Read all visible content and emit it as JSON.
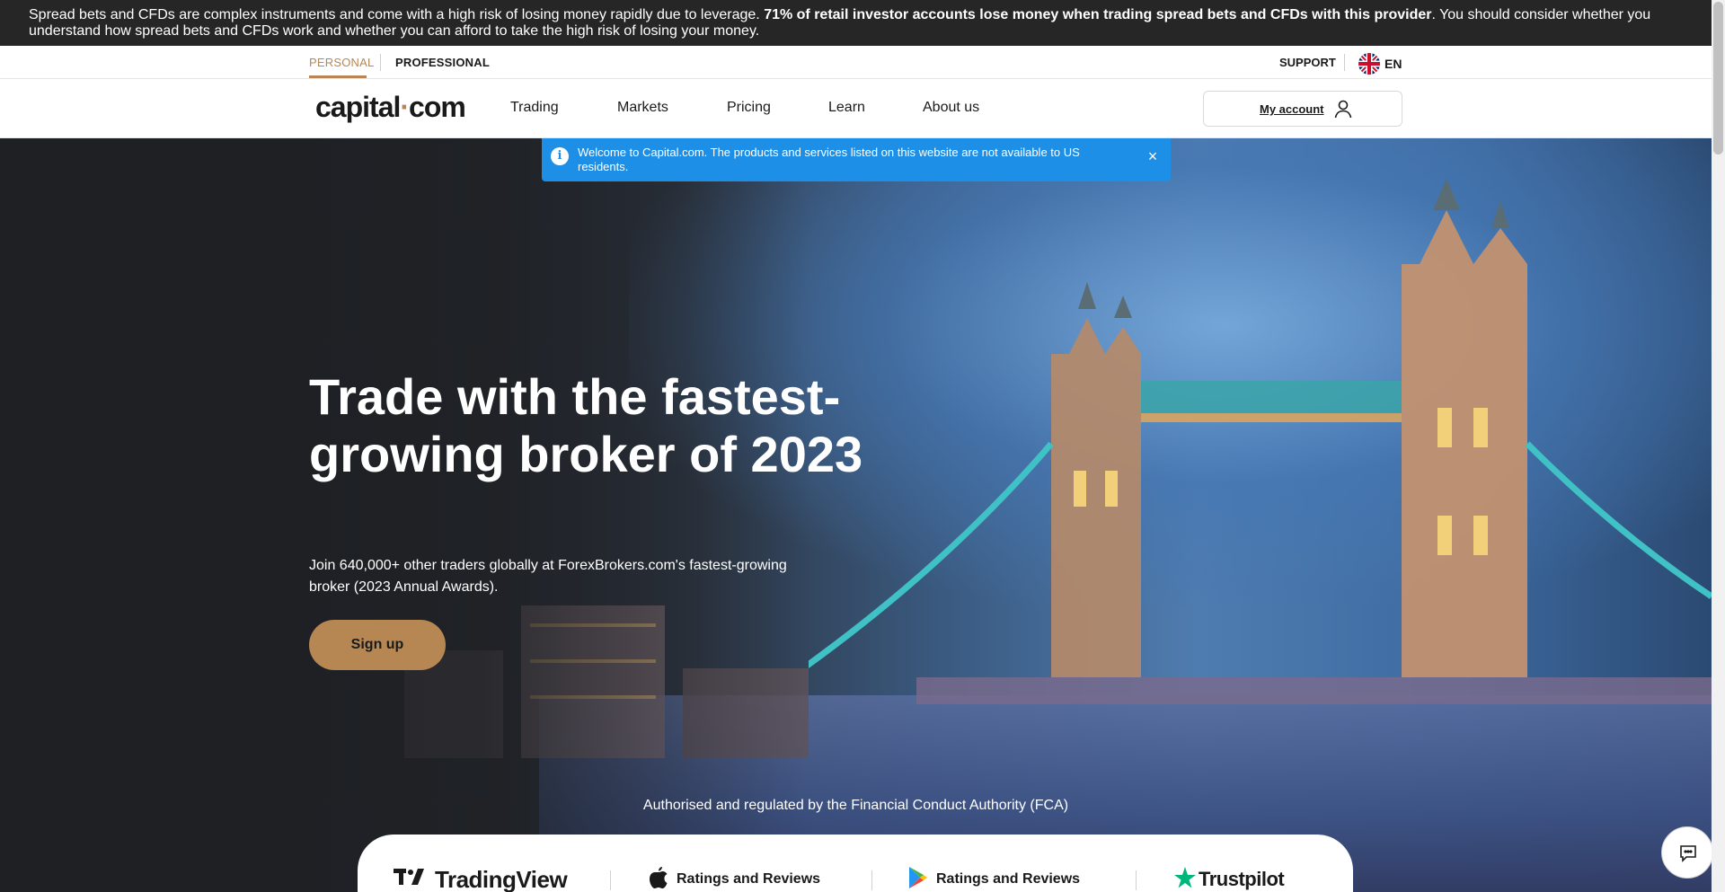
{
  "risk_warning": {
    "text_before": "Spread bets and CFDs are complex instruments and come with a high risk of losing money rapidly due to leverage. ",
    "text_bold": "71% of retail investor accounts lose money when trading spread bets and CFDs with this provider",
    "text_after": ". You should consider whether you understand how spread bets and CFDs work and whether you can afford to take the high risk of losing your money."
  },
  "segments": {
    "personal": "PERSONAL",
    "professional": "PROFESSIONAL"
  },
  "utility": {
    "support": "SUPPORT",
    "language": "EN",
    "language_icon": "uk-flag-icon"
  },
  "header": {
    "logo_left": "capital",
    "logo_dot": "·",
    "logo_right": "com",
    "nav": {
      "trading": "Trading",
      "markets": "Markets",
      "pricing": "Pricing",
      "learn": "Learn",
      "about": "About us"
    },
    "account_label": "My account",
    "account_icon": "user-icon"
  },
  "notice": {
    "icon": "info-icon",
    "text": "Welcome to Capital.com. The products and services listed on this website are not available to US residents.",
    "close": "×"
  },
  "hero": {
    "title": "Trade with the fastest-growing broker of 2023",
    "subtitle": "Join 640,000+ other traders globally at ForexBrokers.com's fastest-growing broker (2023 Annual Awards).",
    "cta": "Sign up",
    "regulated": "Authorised and regulated by the Financial Conduct Authority (FCA)"
  },
  "ratings": {
    "tradingview": "TradingView",
    "apple": "Ratings and Reviews",
    "google": "Ratings and Reviews",
    "trustpilot": "Trustpilot"
  },
  "colors": {
    "brand_gold": "#b68753",
    "notice_blue": "#1e8fe6",
    "risk_bar": "#262626",
    "trustpilot_green": "#00b67a"
  }
}
